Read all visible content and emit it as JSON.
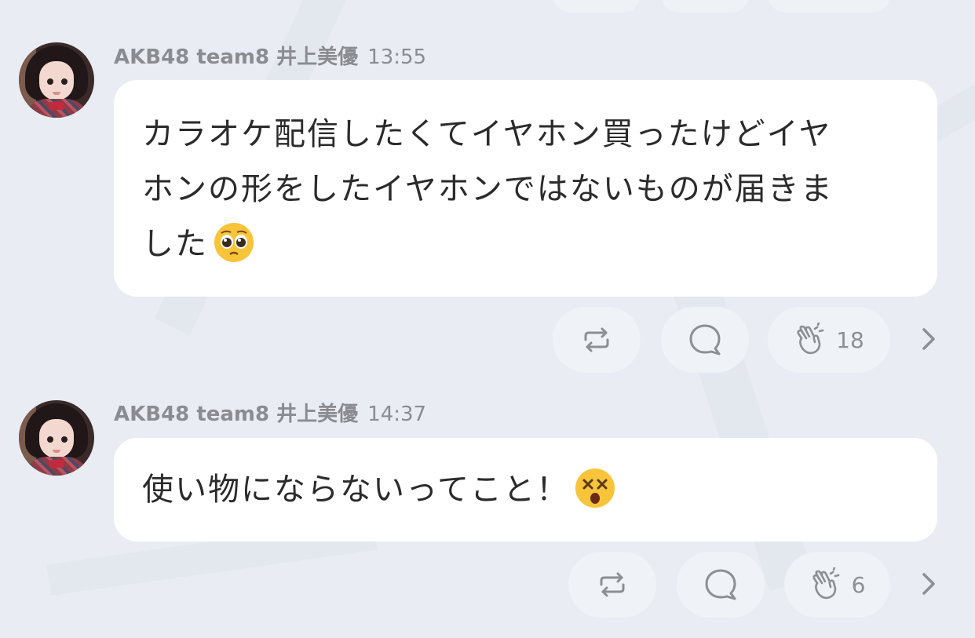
{
  "colors": {
    "background": "#e9edf3",
    "bubble": "#ffffff",
    "pill": "#eff2f6",
    "meta_text": "#8a8c91",
    "message_text": "#2b2b2b"
  },
  "posts": [
    {
      "author": "AKB48 team8 井上美優",
      "time": "13:55",
      "message_lines": [
        "カラオケ配信したくてイヤホン買ったけどイヤ",
        "ホンの形をしたイヤホンではないものが届きま",
        "した"
      ],
      "emoji": "pleading-face-emoji",
      "actions": {
        "repost_icon": "repost-icon",
        "comment_icon": "comment-icon",
        "clap_icon": "clap-icon",
        "clap_count": "18"
      }
    },
    {
      "author": "AKB48 team8 井上美優",
      "time": "14:37",
      "message_lines": [
        "使い物にならないってこと！"
      ],
      "emoji": "dizzy-face-emoji",
      "actions": {
        "repost_icon": "repost-icon",
        "comment_icon": "comment-icon",
        "clap_icon": "clap-icon",
        "clap_count": "6"
      }
    }
  ]
}
